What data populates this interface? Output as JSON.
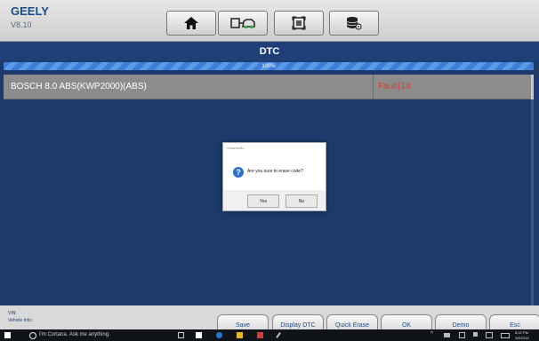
{
  "header": {
    "brand": "GEELY",
    "version": "V8.10",
    "toolbar_icons": [
      "home-icon",
      "car-diagnostic-icon",
      "screenshot-icon",
      "database-settings-icon"
    ]
  },
  "title": "DTC",
  "progress": {
    "label": "100%",
    "value": 100
  },
  "table": {
    "rows": [
      {
        "module": "BOSCH 8.0 ABS(KWP2000)(ABS)",
        "fault": "Fault(18"
      }
    ]
  },
  "dialog": {
    "title": "Smartsoftx",
    "message": "Are you sure to erase code?",
    "yes": "Yes",
    "no": "No",
    "icon": "question-icon"
  },
  "bottom": {
    "vin_label": "VIN:",
    "vehicle_label": "Vehicle Info.:",
    "buttons": [
      "Save",
      "Display DTC",
      "Quick Erase",
      "OK",
      "Demo",
      "Esc"
    ]
  },
  "taskbar": {
    "search_placeholder": "I'm Cortana. Ask me anything.",
    "time": "8:02 PM",
    "date": "3/6/2018"
  },
  "colors": {
    "accent": "#1e3f78",
    "fault": "#e23b2e",
    "background": "#1c3a6b"
  }
}
